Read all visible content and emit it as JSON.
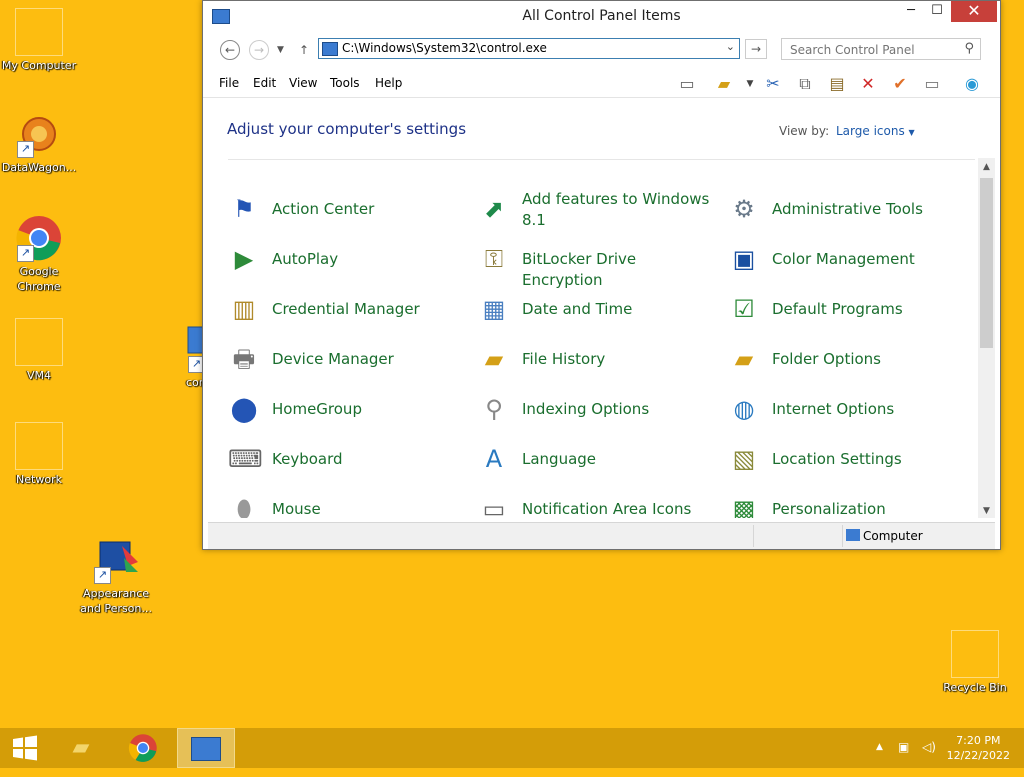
{
  "desktop": {
    "icons": [
      {
        "label": "My Computer"
      },
      {
        "label": "DataWagon..."
      },
      {
        "label": "Google Chrome"
      },
      {
        "label": "VM4"
      },
      {
        "label": "Network"
      },
      {
        "label": "cont"
      },
      {
        "label": "Appearance and Person..."
      },
      {
        "label": "Recycle Bin"
      }
    ]
  },
  "window": {
    "title": "All Control Panel Items",
    "address": "C:\\Windows\\System32\\control.exe",
    "search_placeholder": "Search Control Panel",
    "menu": [
      "File",
      "Edit",
      "View",
      "Tools",
      "Help"
    ],
    "heading": "Adjust your computer's settings",
    "view_by_label": "View by:",
    "view_by_value": "Large icons",
    "items": [
      {
        "label": "Action Center",
        "icon": "flag-icon"
      },
      {
        "label": "Add features to Windows 8.1",
        "icon": "add-features-icon"
      },
      {
        "label": "Administrative Tools",
        "icon": "admin-tools-icon"
      },
      {
        "label": "AutoPlay",
        "icon": "autoplay-icon"
      },
      {
        "label": "BitLocker Drive Encryption",
        "icon": "key-icon"
      },
      {
        "label": "Color Management",
        "icon": "color-management-icon"
      },
      {
        "label": "Credential Manager",
        "icon": "vault-icon"
      },
      {
        "label": "Date and Time",
        "icon": "clock-calendar-icon"
      },
      {
        "label": "Default Programs",
        "icon": "default-programs-icon"
      },
      {
        "label": "Device Manager",
        "icon": "device-manager-icon"
      },
      {
        "label": "File History",
        "icon": "file-history-icon"
      },
      {
        "label": "Folder Options",
        "icon": "folder-options-icon"
      },
      {
        "label": "HomeGroup",
        "icon": "homegroup-icon"
      },
      {
        "label": "Indexing Options",
        "icon": "indexing-icon"
      },
      {
        "label": "Internet Options",
        "icon": "globe-icon"
      },
      {
        "label": "Keyboard",
        "icon": "keyboard-icon"
      },
      {
        "label": "Language",
        "icon": "language-icon"
      },
      {
        "label": "Location Settings",
        "icon": "location-icon"
      },
      {
        "label": "Mouse",
        "icon": "mouse-icon"
      },
      {
        "label": "Notification Area Icons",
        "icon": "notification-icon"
      },
      {
        "label": "Personalization",
        "icon": "personalization-icon"
      }
    ],
    "status": "Computer"
  },
  "taskbar": {
    "time": "7:20 PM",
    "date": "12/22/2022"
  },
  "colors": {
    "desktop": "#fdbd10",
    "taskbar": "#d49d08",
    "link": "#1a6e2e",
    "heading": "#1e3287",
    "close": "#c7403a"
  }
}
